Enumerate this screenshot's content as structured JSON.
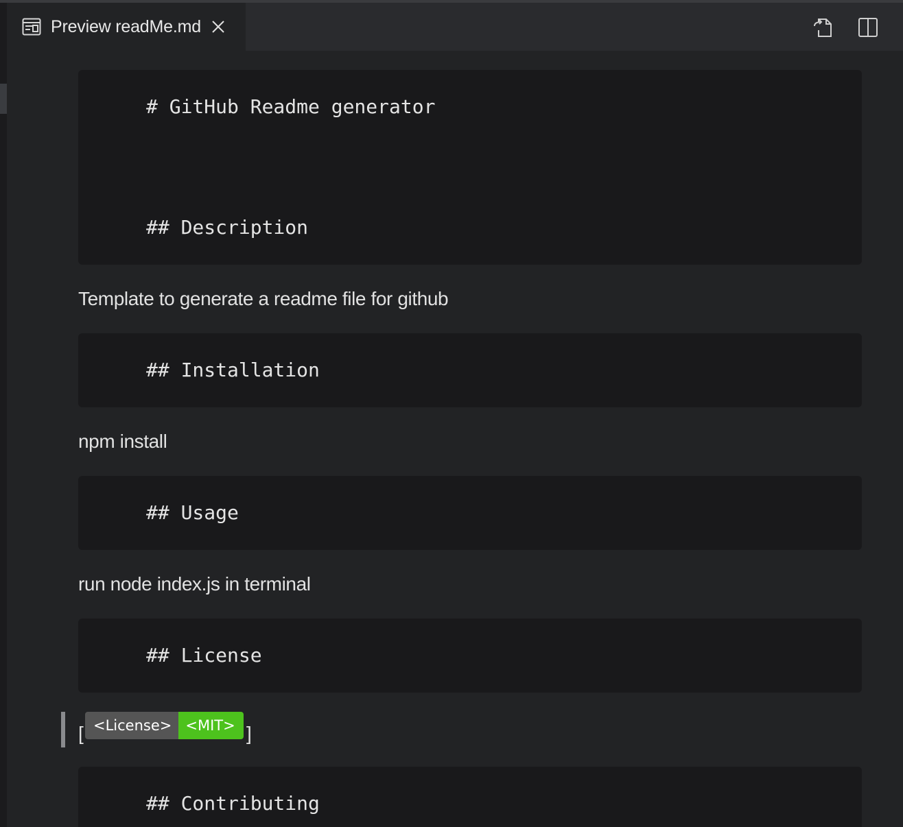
{
  "tab": {
    "icon": "preview-icon",
    "title": "Preview readMe.md",
    "close_icon": "close-icon"
  },
  "toolbar": {
    "open_source_icon": "open-source-icon",
    "split_editor_icon": "split-editor-icon"
  },
  "document": {
    "block_title": "# GitHub Readme generator",
    "block_description": "## Description",
    "description_text": "Template to generate a readme file for github",
    "block_installation": "## Installation",
    "installation_text": "npm install",
    "block_usage": "## Usage",
    "usage_text": "run node index.js in terminal",
    "block_license": "## License",
    "license_bracket_open": "[",
    "license_bracket_close": "]",
    "badge": {
      "label": "<License>",
      "value": "<MIT>",
      "label_color": "#555555",
      "value_color": "#4dc21d"
    },
    "block_contributing": "## Contributing"
  },
  "colors": {
    "background": "#222325",
    "code_block": "#19191b",
    "tabbar": "#2a2b2e"
  }
}
